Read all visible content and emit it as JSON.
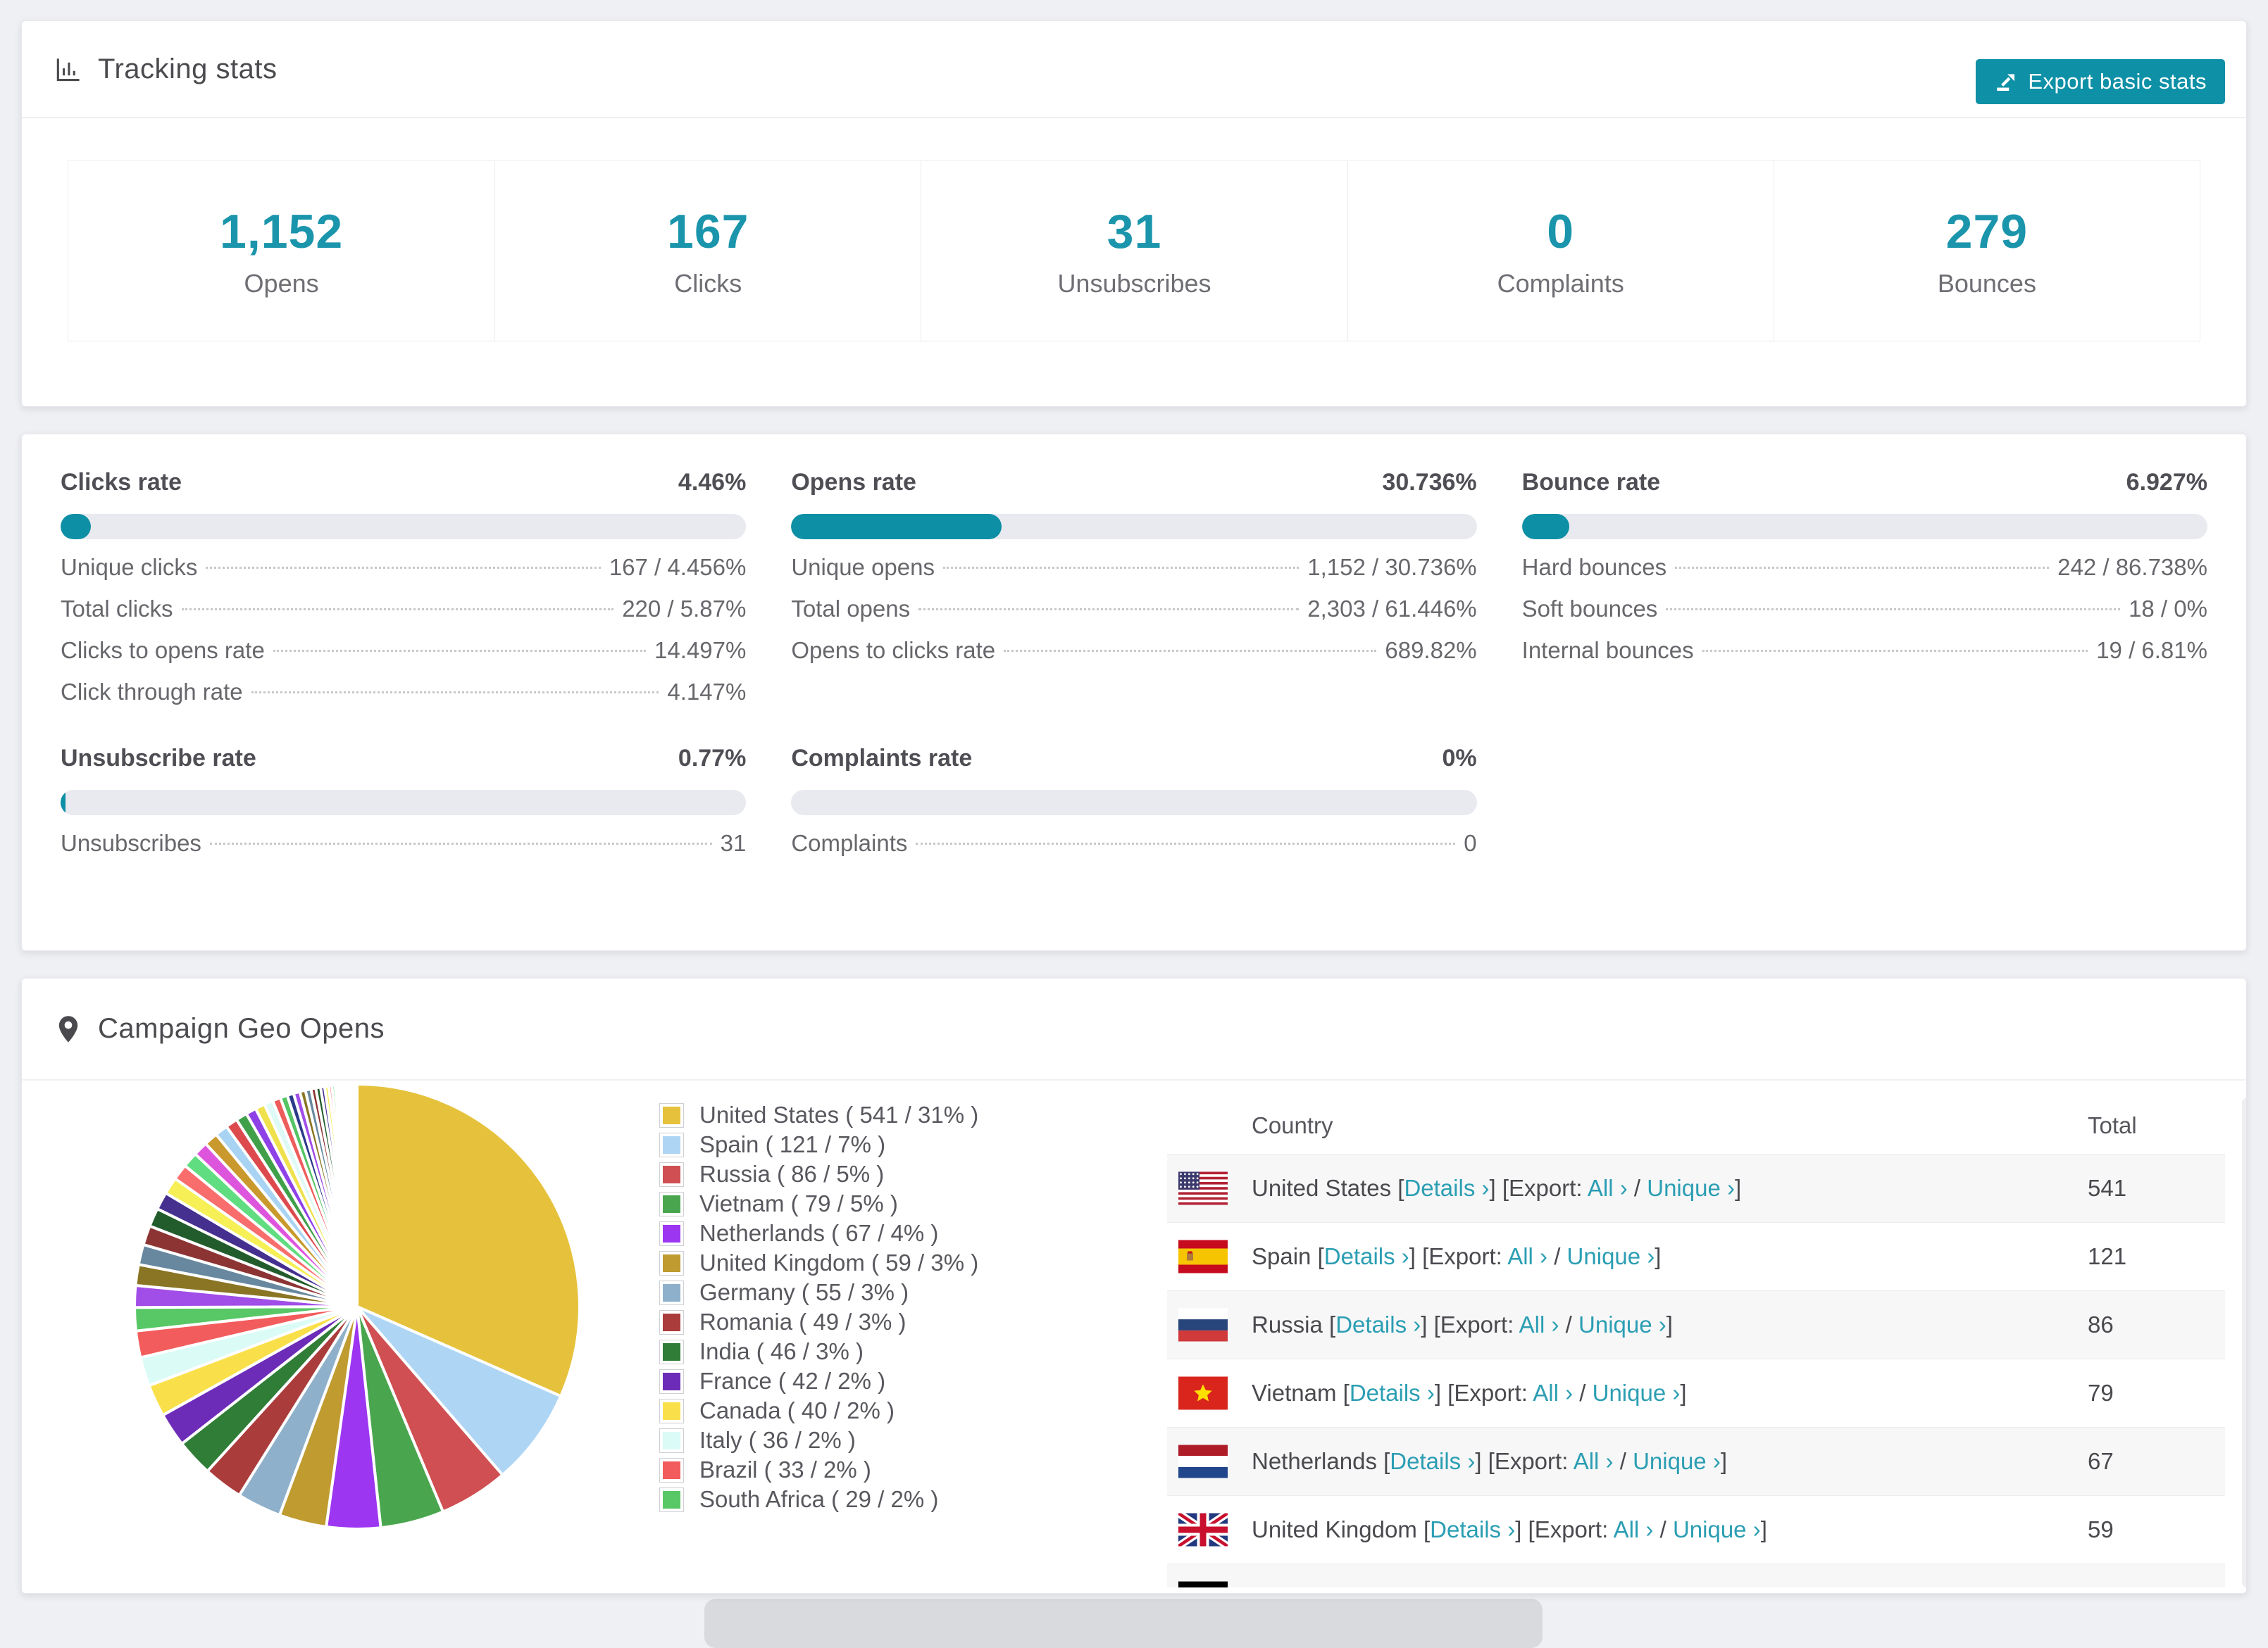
{
  "accent": "#0e90a6",
  "tracking": {
    "title": "Tracking stats",
    "export_label": "Export basic stats",
    "stats": [
      {
        "value": "1,152",
        "label": "Opens"
      },
      {
        "value": "167",
        "label": "Clicks"
      },
      {
        "value": "31",
        "label": "Unsubscribes"
      },
      {
        "value": "0",
        "label": "Complaints"
      },
      {
        "value": "279",
        "label": "Bounces"
      }
    ]
  },
  "rates": [
    {
      "title": "Clicks rate",
      "value": "4.46%",
      "pct": 4.46,
      "rows": [
        [
          "Unique clicks",
          "167 / 4.456%"
        ],
        [
          "Total clicks",
          "220 / 5.87%"
        ],
        [
          "Clicks to opens rate",
          "14.497%"
        ],
        [
          "Click through rate",
          "4.147%"
        ]
      ]
    },
    {
      "title": "Opens rate",
      "value": "30.736%",
      "pct": 30.736,
      "rows": [
        [
          "Unique opens",
          "1,152 / 30.736%"
        ],
        [
          "Total opens",
          "2,303 / 61.446%"
        ],
        [
          "Opens to clicks rate",
          "689.82%"
        ]
      ]
    },
    {
      "title": "Bounce rate",
      "value": "6.927%",
      "pct": 6.927,
      "rows": [
        [
          "Hard bounces",
          "242 / 86.738%"
        ],
        [
          "Soft bounces",
          "18 / 0%"
        ],
        [
          "Internal bounces",
          "19 / 6.81%"
        ]
      ]
    },
    {
      "title": "Unsubscribe rate",
      "value": "0.77%",
      "pct": 0.77,
      "rows": [
        [
          "Unsubscribes",
          "31"
        ]
      ]
    },
    {
      "title": "Complaints rate",
      "value": "0%",
      "pct": 0,
      "rows": [
        [
          "Complaints",
          "0"
        ]
      ]
    }
  ],
  "geo": {
    "title": "Campaign Geo Opens",
    "table": {
      "headers": [
        "Country",
        "Total"
      ],
      "fmt": {
        "open": "[",
        "close": "]",
        "details": "Details ›",
        "export_prefix": "Export:",
        "all": "All ›",
        "slash": "/",
        "unique": "Unique ›"
      },
      "rows": [
        {
          "flag": "us",
          "country": "United States",
          "total": "541"
        },
        {
          "flag": "es",
          "country": "Spain",
          "total": "121"
        },
        {
          "flag": "ru",
          "country": "Russia",
          "total": "86"
        },
        {
          "flag": "vn",
          "country": "Vietnam",
          "total": "79"
        },
        {
          "flag": "nl",
          "country": "Netherlands",
          "total": "67"
        },
        {
          "flag": "gb",
          "country": "United Kingdom",
          "total": "59"
        },
        {
          "flag": "de",
          "country": "",
          "total": ""
        }
      ]
    }
  },
  "chart_data": {
    "type": "pie",
    "title": "Campaign Geo Opens",
    "legend_position": "right",
    "series": [
      {
        "name": "United States",
        "value": 541,
        "pct": "31%",
        "color": "#e6c23c"
      },
      {
        "name": "Spain",
        "value": 121,
        "pct": "7%",
        "color": "#aed5f4"
      },
      {
        "name": "Russia",
        "value": 86,
        "pct": "5%",
        "color": "#cf4f52"
      },
      {
        "name": "Vietnam",
        "value": 79,
        "pct": "5%",
        "color": "#4aa64e"
      },
      {
        "name": "Netherlands",
        "value": 67,
        "pct": "4%",
        "color": "#9c36f1"
      },
      {
        "name": "United Kingdom",
        "value": 59,
        "pct": "3%",
        "color": "#bf9b30"
      },
      {
        "name": "Germany",
        "value": 55,
        "pct": "3%",
        "color": "#8fb0ca"
      },
      {
        "name": "Romania",
        "value": 49,
        "pct": "3%",
        "color": "#ab3c3c"
      },
      {
        "name": "India",
        "value": 46,
        "pct": "3%",
        "color": "#2f7d36"
      },
      {
        "name": "France",
        "value": 42,
        "pct": "2%",
        "color": "#6d2cb8"
      },
      {
        "name": "Canada",
        "value": 40,
        "pct": "2%",
        "color": "#f9e04b"
      },
      {
        "name": "Italy",
        "value": 36,
        "pct": "2%",
        "color": "#dbfbf7"
      },
      {
        "name": "Brazil",
        "value": 33,
        "pct": "2%",
        "color": "#f35c5c"
      },
      {
        "name": "South Africa",
        "value": 29,
        "pct": "2%",
        "color": "#58c765"
      }
    ],
    "others_values": [
      27,
      26,
      25,
      24,
      23,
      22,
      21,
      20,
      19,
      18,
      17,
      16,
      15,
      14,
      13,
      12,
      11,
      10,
      9,
      8,
      8,
      7,
      7,
      6,
      6,
      5,
      5,
      4,
      4,
      3,
      3,
      3,
      2,
      2,
      2,
      2,
      1,
      1,
      1,
      1,
      1,
      1,
      1,
      1,
      1,
      1
    ],
    "others_palette": [
      "#a14de8",
      "#8a7524",
      "#67889f",
      "#8c3434",
      "#235c2c",
      "#45308f",
      "#f6ef55",
      "#f96d6d",
      "#60dd80",
      "#dd55dd",
      "#c9992e",
      "#a9d3f2",
      "#dd4a4e",
      "#3fa049",
      "#8f41e8",
      "#efe14b",
      "#ddfaf6",
      "#ef5c5c",
      "#55c465",
      "#2c3a8a"
    ]
  }
}
